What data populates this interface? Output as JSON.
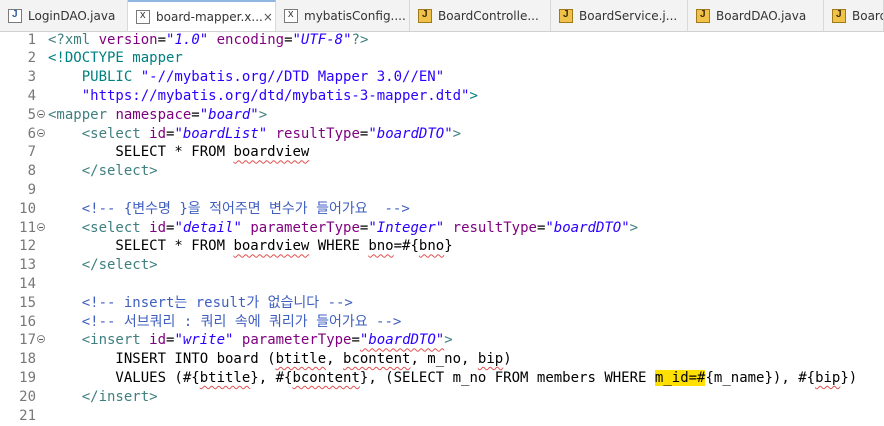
{
  "tabs": [
    {
      "label": "LoginDAO.java",
      "icon": "java-file-icon",
      "width": 128,
      "active": false,
      "close": false
    },
    {
      "label": "board-mapper.x...",
      "icon": "xml-file-icon",
      "width": 148,
      "active": true,
      "close": true
    },
    {
      "label": "mybatisConfig....",
      "icon": "xml-file-icon",
      "width": 134,
      "active": false,
      "close": false
    },
    {
      "label": "BoardControlle...",
      "icon": "java-class-icon",
      "width": 141,
      "active": false,
      "close": false
    },
    {
      "label": "BoardService.j...",
      "icon": "java-class-icon",
      "width": 137,
      "active": false,
      "close": false
    },
    {
      "label": "BoardDAO.java",
      "icon": "java-class-icon",
      "width": 136,
      "active": false,
      "close": false
    },
    {
      "label": "BoardD",
      "icon": "java-class-icon",
      "width": 60,
      "active": false,
      "close": false
    }
  ],
  "editor": {
    "lines": [
      {
        "n": "1",
        "fold": false,
        "tokens": [
          {
            "c": "t",
            "s": "<?xml "
          },
          {
            "c": "a",
            "s": "version"
          },
          {
            "c": "",
            "s": "="
          },
          {
            "c": "v",
            "s": "\"1.0\""
          },
          {
            "c": "",
            "s": " "
          },
          {
            "c": "a",
            "s": "encoding"
          },
          {
            "c": "",
            "s": "="
          },
          {
            "c": "v",
            "s": "\"UTF-8\""
          },
          {
            "c": "t",
            "s": "?>"
          }
        ]
      },
      {
        "n": "2",
        "fold": false,
        "tokens": [
          {
            "c": "d",
            "s": "<!DOCTYPE mapper"
          }
        ]
      },
      {
        "n": "3",
        "fold": false,
        "tokens": [
          {
            "c": "d",
            "s": "    PUBLIC "
          },
          {
            "c": "ds",
            "s": "\"-//mybatis.org//DTD Mapper 3.0//EN\""
          }
        ]
      },
      {
        "n": "4",
        "fold": false,
        "tokens": [
          {
            "c": "ds",
            "s": "    \"https://mybatis.org/dtd/mybatis-3-mapper.dtd\""
          },
          {
            "c": "d",
            "s": ">"
          }
        ]
      },
      {
        "n": "5",
        "fold": true,
        "tokens": [
          {
            "c": "t",
            "s": "<mapper "
          },
          {
            "c": "a",
            "s": "namespace"
          },
          {
            "c": "",
            "s": "="
          },
          {
            "c": "v",
            "s": "\"board\""
          },
          {
            "c": "t",
            "s": ">"
          }
        ]
      },
      {
        "n": "6",
        "fold": true,
        "tokens": [
          {
            "c": "",
            "s": "    "
          },
          {
            "c": "t",
            "s": "<select "
          },
          {
            "c": "a",
            "s": "id"
          },
          {
            "c": "",
            "s": "="
          },
          {
            "c": "v",
            "s": "\"boardList\""
          },
          {
            "c": "",
            "s": " "
          },
          {
            "c": "a",
            "s": "resultType"
          },
          {
            "c": "",
            "s": "="
          },
          {
            "c": "v",
            "s": "\"boardDTO\""
          },
          {
            "c": "t",
            "s": ">"
          }
        ]
      },
      {
        "n": "7",
        "fold": false,
        "tokens": [
          {
            "c": "",
            "s": "        SELECT * FROM "
          },
          {
            "c": "sq",
            "s": "boardview"
          }
        ]
      },
      {
        "n": "8",
        "fold": false,
        "tokens": [
          {
            "c": "",
            "s": "    "
          },
          {
            "c": "t",
            "s": "</select>"
          }
        ]
      },
      {
        "n": "9",
        "fold": false,
        "tokens": [
          {
            "c": "",
            "s": ""
          }
        ]
      },
      {
        "n": "10",
        "fold": false,
        "tokens": [
          {
            "c": "",
            "s": "    "
          },
          {
            "c": "cm",
            "s": "<!-- {변수명 }을 적어주면 변수가 들어가요  -->"
          }
        ]
      },
      {
        "n": "11",
        "fold": true,
        "tokens": [
          {
            "c": "",
            "s": "    "
          },
          {
            "c": "t",
            "s": "<select "
          },
          {
            "c": "a",
            "s": "id"
          },
          {
            "c": "",
            "s": "="
          },
          {
            "c": "v",
            "s": "\"detail\""
          },
          {
            "c": "",
            "s": " "
          },
          {
            "c": "a",
            "s": "parameterType"
          },
          {
            "c": "",
            "s": "="
          },
          {
            "c": "v",
            "s": "\"Integer\""
          },
          {
            "c": "",
            "s": " "
          },
          {
            "c": "a",
            "s": "resultType"
          },
          {
            "c": "",
            "s": "="
          },
          {
            "c": "v",
            "s": "\"boardDTO\""
          },
          {
            "c": "t",
            "s": ">"
          }
        ]
      },
      {
        "n": "12",
        "fold": false,
        "tokens": [
          {
            "c": "",
            "s": "        SELECT * FROM "
          },
          {
            "c": "sq",
            "s": "boardview"
          },
          {
            "c": "",
            "s": " WHERE "
          },
          {
            "c": "sq",
            "s": "bno"
          },
          {
            "c": "",
            "s": "=#{"
          },
          {
            "c": "sq",
            "s": "bno"
          },
          {
            "c": "",
            "s": "}"
          }
        ]
      },
      {
        "n": "13",
        "fold": false,
        "tokens": [
          {
            "c": "",
            "s": "    "
          },
          {
            "c": "t",
            "s": "</select>"
          }
        ]
      },
      {
        "n": "14",
        "fold": false,
        "tokens": [
          {
            "c": "",
            "s": ""
          }
        ]
      },
      {
        "n": "15",
        "fold": false,
        "tokens": [
          {
            "c": "",
            "s": "    "
          },
          {
            "c": "cm",
            "s": "<!-- insert는 result가 없습니다 -->"
          }
        ]
      },
      {
        "n": "16",
        "fold": false,
        "tokens": [
          {
            "c": "",
            "s": "    "
          },
          {
            "c": "cm",
            "s": "<!-- 서브쿼리 : 쿼리 속에 쿼리가 들어가요 -->"
          }
        ]
      },
      {
        "n": "17",
        "fold": true,
        "tokens": [
          {
            "c": "",
            "s": "    "
          },
          {
            "c": "t",
            "s": "<insert "
          },
          {
            "c": "a",
            "s": "id"
          },
          {
            "c": "",
            "s": "="
          },
          {
            "c": "v",
            "s": "\"write\""
          },
          {
            "c": "",
            "s": " "
          },
          {
            "c": "a",
            "s": "parameterType"
          },
          {
            "c": "",
            "s": "="
          },
          {
            "c": "v sq",
            "s": "\"boardDTO\""
          },
          {
            "c": "t",
            "s": ">"
          }
        ]
      },
      {
        "n": "18",
        "fold": false,
        "tokens": [
          {
            "c": "",
            "s": "        INSERT INTO board ("
          },
          {
            "c": "sq",
            "s": "btitle"
          },
          {
            "c": "",
            "s": ", "
          },
          {
            "c": "sq",
            "s": "bcontent"
          },
          {
            "c": "",
            "s": ", m_no, "
          },
          {
            "c": "sq",
            "s": "bip"
          },
          {
            "c": "",
            "s": ")"
          }
        ]
      },
      {
        "n": "19",
        "fold": false,
        "tokens": [
          {
            "c": "",
            "s": "        VALUES (#{"
          },
          {
            "c": "sq",
            "s": "btitle"
          },
          {
            "c": "",
            "s": "}, #{"
          },
          {
            "c": "sq",
            "s": "bcontent"
          },
          {
            "c": "",
            "s": "}, (SELECT m_no FROM members WHERE "
          },
          {
            "c": "hl",
            "s": "m_id=#"
          },
          {
            "c": "",
            "s": "{m_name}), #{"
          },
          {
            "c": "sq",
            "s": "bip"
          },
          {
            "c": "",
            "s": "})"
          }
        ]
      },
      {
        "n": "20",
        "fold": false,
        "tokens": [
          {
            "c": "",
            "s": "    "
          },
          {
            "c": "t",
            "s": "</insert>"
          }
        ]
      },
      {
        "n": "21",
        "fold": false,
        "tokens": [
          {
            "c": "",
            "s": ""
          }
        ]
      }
    ]
  }
}
